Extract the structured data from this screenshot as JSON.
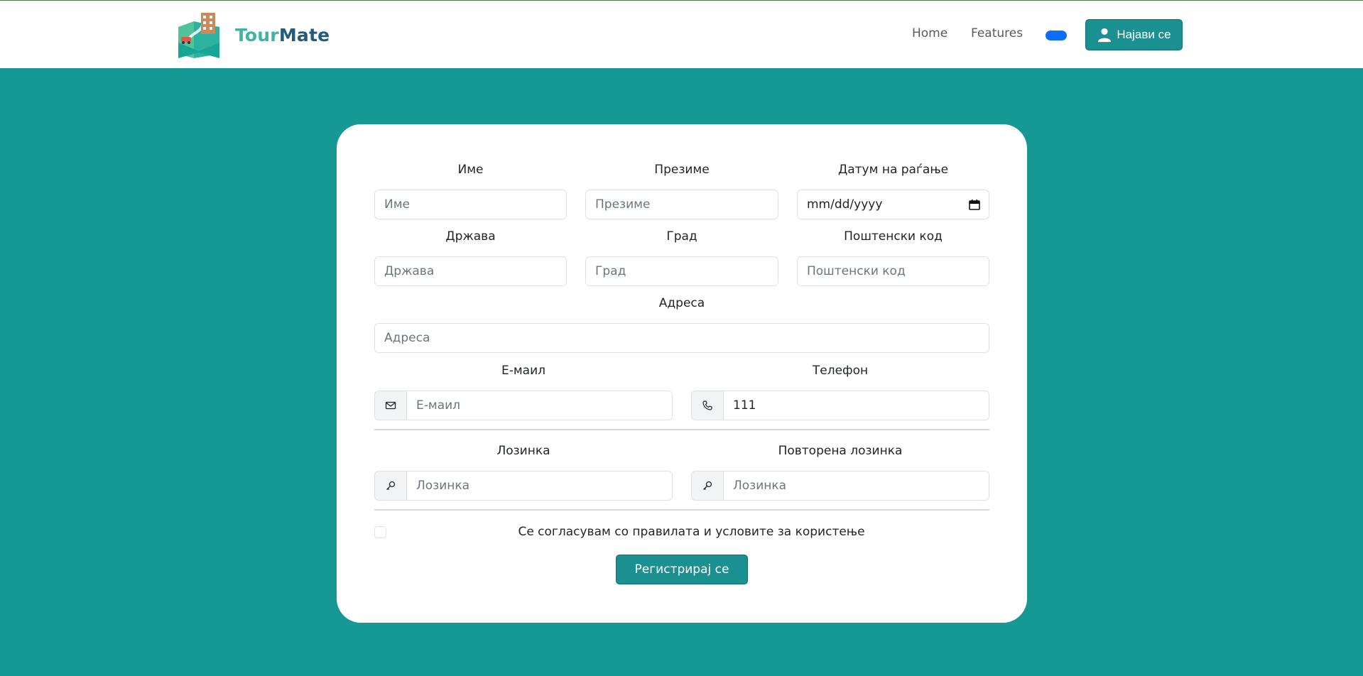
{
  "navbar": {
    "brand_first": "Tour",
    "brand_second": "Mate",
    "home_label": "Home",
    "features_label": "Features",
    "login_label": "Најави се",
    "login_icon": "user-icon"
  },
  "form": {
    "first_name": {
      "label": "Име",
      "placeholder": "Име"
    },
    "last_name": {
      "label": "Презиме",
      "placeholder": "Презиме"
    },
    "birth_date": {
      "label": "Датум на раѓање",
      "value": "mm/dd/yyyy",
      "icon": "calendar-icon"
    },
    "country": {
      "label": "Држава",
      "placeholder": "Држава"
    },
    "city": {
      "label": "Град",
      "placeholder": "Град"
    },
    "postal_code": {
      "label": "Поштенски код",
      "placeholder": "Поштенски код"
    },
    "address": {
      "label": "Адреса",
      "placeholder": "Адреса"
    },
    "email": {
      "label": "Е-маил",
      "placeholder": "Е-маил",
      "icon": "envelope-icon"
    },
    "phone": {
      "label": "Телефон",
      "value": "111",
      "icon": "phone-icon"
    },
    "password": {
      "label": "Лозинка",
      "placeholder": "Лозинка",
      "icon": "key-icon"
    },
    "password_repeat": {
      "label": "Повторена лозинка",
      "placeholder": "Лозинка",
      "icon": "key-icon"
    },
    "terms_label": "Се согласувам со правилата и условите за користење",
    "terms_checked": false,
    "submit_label": "Регистрирај се"
  },
  "colors": {
    "page_background": "#169894",
    "primary_button": "#1a9090",
    "toggle": "#0d6efd",
    "brand_light": "#3fb3a6",
    "brand_dark": "#1f5d7a"
  }
}
